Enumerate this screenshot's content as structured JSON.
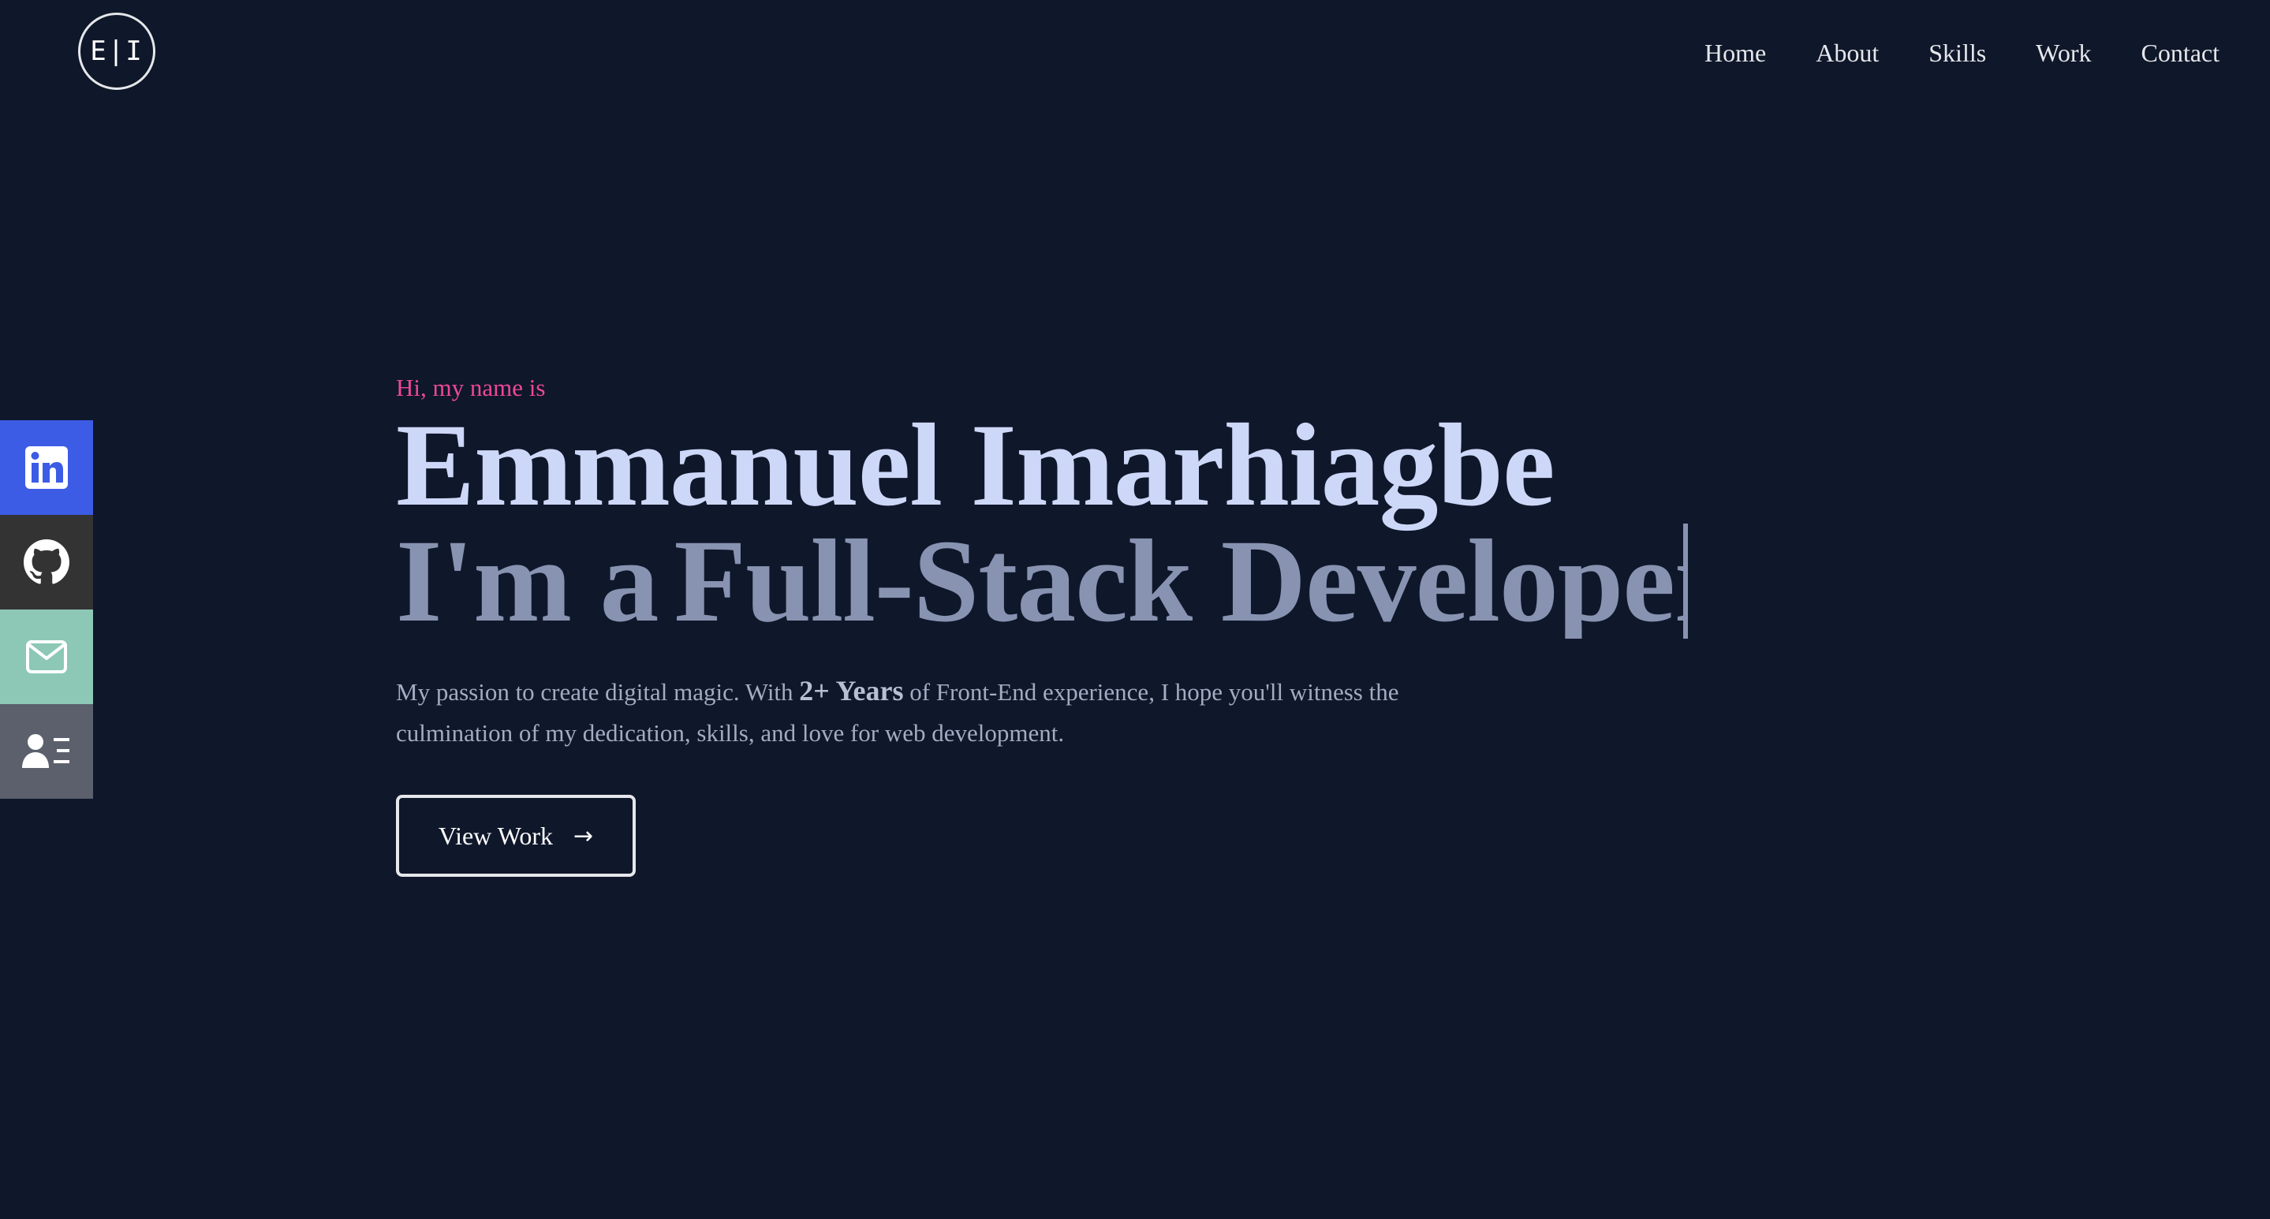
{
  "header": {
    "logo_text": "E|I",
    "nav": [
      "Home",
      "About",
      "Skills",
      "Work",
      "Contact"
    ]
  },
  "social": [
    {
      "name": "linkedin-icon",
      "color": "#3c5ce6"
    },
    {
      "name": "github-icon",
      "color": "#333333"
    },
    {
      "name": "mail-icon",
      "color": "#8cc8b5"
    },
    {
      "name": "resume-icon",
      "color": "#5b606c"
    }
  ],
  "hero": {
    "greeting": "Hi, my name is",
    "name": "Emmanuel Imarhiagbe",
    "role_prefix": "I'm a",
    "role_typed": "Full-Stack Developer",
    "bio_before": "My passion to create digital magic. With ",
    "bio_highlight": "2+ Years",
    "bio_after": " of Front-End experience, I hope you'll witness the culmination of my dedication, skills, and love for web development.",
    "cta_label": "View Work",
    "cta_icon": "arrow-right-icon"
  },
  "colors": {
    "background": "#0f172a",
    "accent": "#ec4899",
    "name": "#cdd7f7",
    "role": "#8793b1"
  }
}
